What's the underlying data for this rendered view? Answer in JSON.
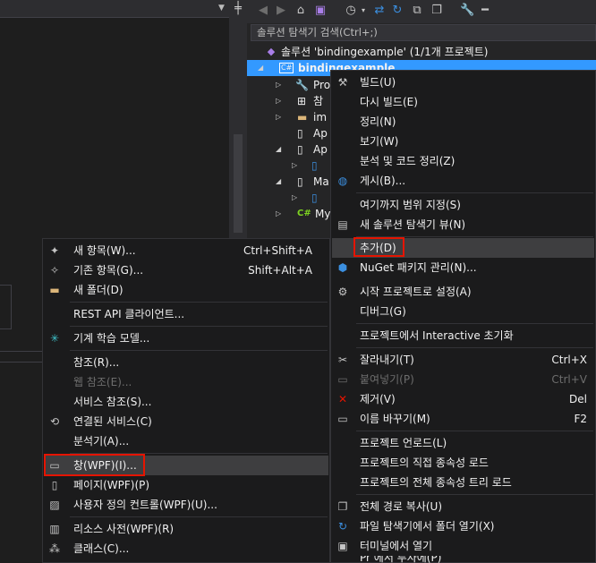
{
  "solution_explorer": {
    "search_placeholder": "솔루션 탐색기 검색(Ctrl+;)",
    "solution_label": "솔루션 'bindingexample' (1/1개 프로젝트)",
    "project_label": "bindingexample",
    "tree_items": [
      "Pro",
      "참",
      "im",
      "Ap",
      "Ap",
      "",
      "Ma",
      "",
      "My"
    ]
  },
  "context_menu": {
    "items": [
      {
        "label": "빌드(U)",
        "icon": "build-icon"
      },
      {
        "label": "다시 빌드(E)"
      },
      {
        "label": "정리(N)"
      },
      {
        "label": "보기(W)"
      },
      {
        "label": "분석 및 코드 정리(Z)"
      },
      {
        "label": "게시(B)...",
        "icon": "globe-icon"
      },
      {
        "label": "여기까지 범위 지정(S)"
      },
      {
        "label": "새 솔루션 탐색기 뷰(N)",
        "icon": "new-view-icon"
      },
      {
        "label": "추가(D)"
      },
      {
        "label": "NuGet 패키지 관리(N)...",
        "icon": "nuget-icon"
      },
      {
        "label": "시작 프로젝트로 설정(A)",
        "icon": "gear-icon"
      },
      {
        "label": "디버그(G)"
      },
      {
        "label": "프로젝트에서 Interactive 초기화"
      },
      {
        "label": "잘라내기(T)",
        "shortcut": "Ctrl+X",
        "icon": "scissors-icon"
      },
      {
        "label": "붙여넣기(P)",
        "shortcut": "Ctrl+V",
        "disabled": true,
        "icon": "paste-icon"
      },
      {
        "label": "제거(V)",
        "shortcut": "Del",
        "icon": "delete-icon"
      },
      {
        "label": "이름 바꾸기(M)",
        "shortcut": "F2",
        "icon": "rename-icon"
      },
      {
        "label": "프로젝트 언로드(L)"
      },
      {
        "label": "프로젝트의 직접 종속성 로드"
      },
      {
        "label": "프로젝트의 전체 종속성 트리 로드"
      },
      {
        "label": "전체 경로 복사(U)",
        "icon": "copy-icon"
      },
      {
        "label": "파일 탐색기에서 폴더 열기(X)",
        "icon": "refresh-icon"
      },
      {
        "label": "터미널에서 열기",
        "icon": "terminal-icon"
      },
      {
        "label": "Pr       에서 투자에(P)"
      }
    ]
  },
  "add_submenu": {
    "items": [
      {
        "label": "새 항목(W)...",
        "shortcut": "Ctrl+Shift+A"
      },
      {
        "label": "기존 항목(G)...",
        "shortcut": "Shift+Alt+A"
      },
      {
        "label": "새 폴더(D)"
      },
      {
        "label": "REST API 클라이언트..."
      },
      {
        "label": "기계 학습 모델..."
      },
      {
        "label": "참조(R)..."
      },
      {
        "label": "웹 참조(E)...",
        "disabled": true
      },
      {
        "label": "서비스 참조(S)..."
      },
      {
        "label": "연결된 서비스(C)"
      },
      {
        "label": "분석기(A)..."
      },
      {
        "label": "창(WPF)(I)..."
      },
      {
        "label": "페이지(WPF)(P)"
      },
      {
        "label": "사용자 정의 컨트롤(WPF)(U)..."
      },
      {
        "label": "리소스 사전(WPF)(R)"
      },
      {
        "label": "클래스(C)..."
      }
    ]
  },
  "colors": {
    "accent": "#3399ff",
    "highlight_box": "#e51400",
    "menu_bg": "#1b1b1c"
  }
}
